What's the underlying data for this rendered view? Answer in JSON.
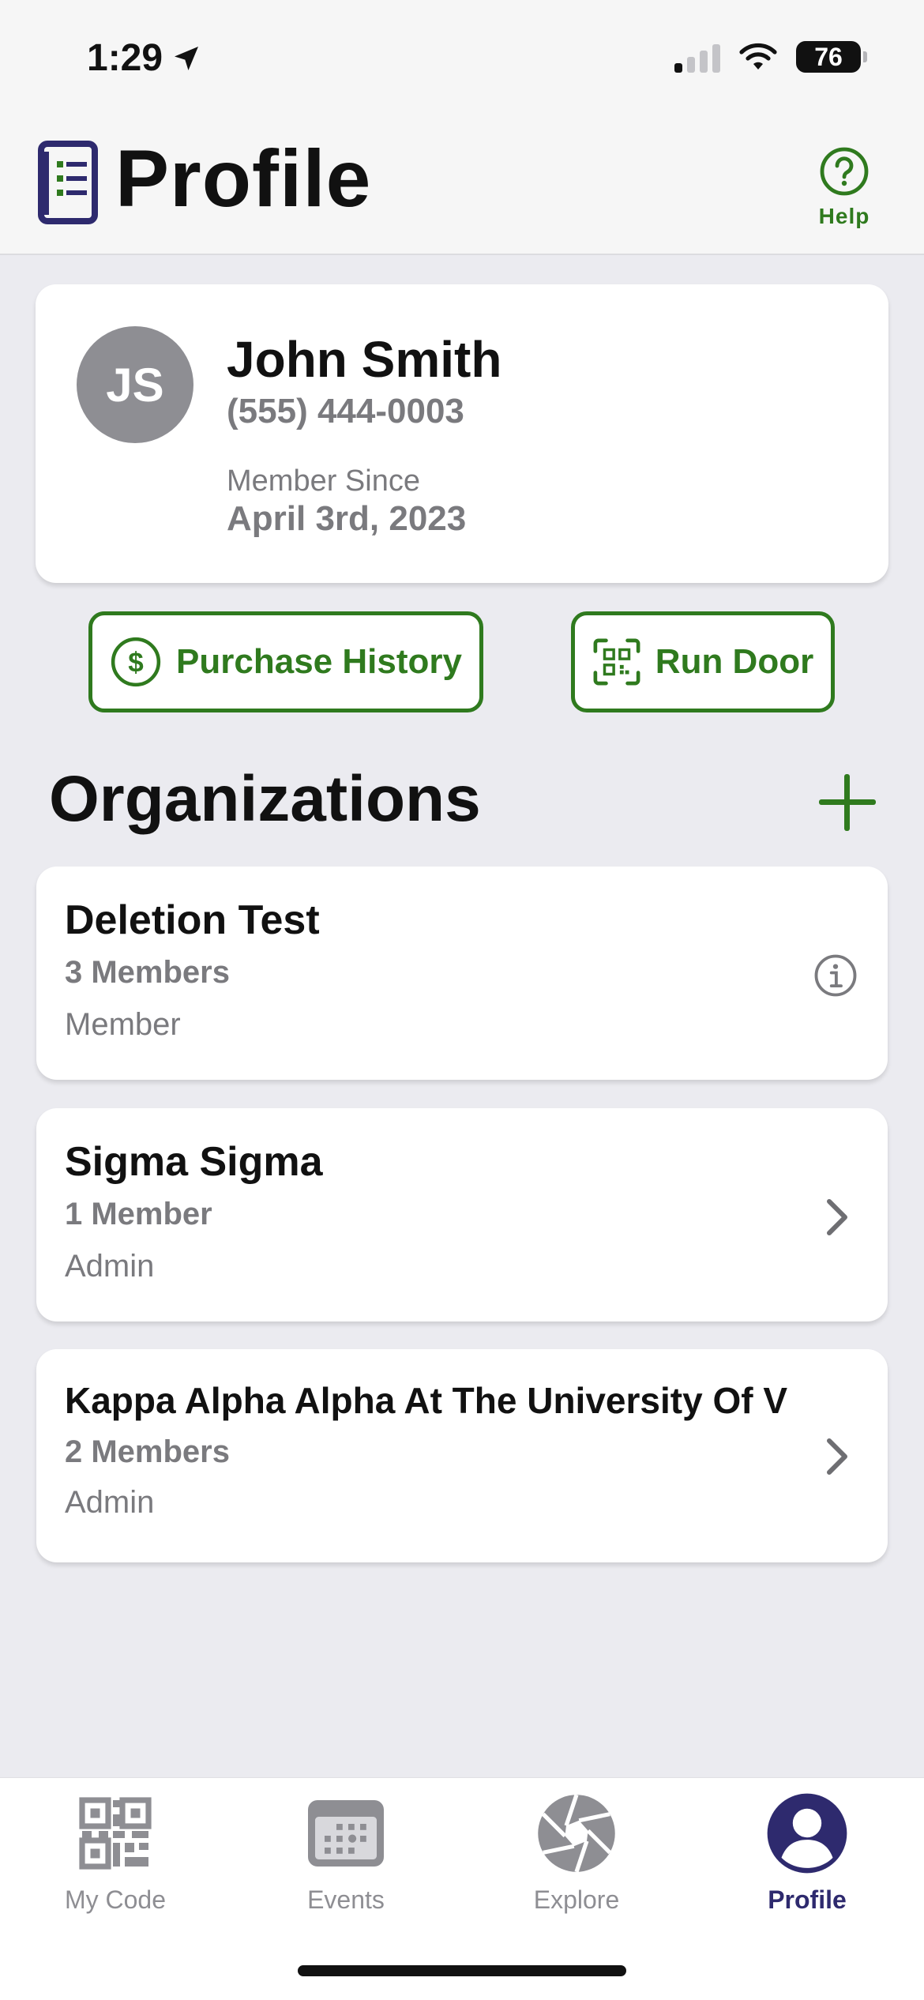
{
  "status_bar": {
    "time": "1:29",
    "battery": "76"
  },
  "header": {
    "title": "Profile",
    "help_label": "Help"
  },
  "profile": {
    "initials": "JS",
    "name": "John Smith",
    "phone": "(555) 444-0003",
    "member_since_label": "Member Since",
    "member_since_date": "April 3rd, 2023"
  },
  "actions": {
    "purchase_history": "Purchase History",
    "run_door": "Run Door"
  },
  "organizations": {
    "title": "Organizations",
    "items": [
      {
        "name": "Deletion Test",
        "members": "3 Members",
        "role": "Member",
        "icon": "info-icon"
      },
      {
        "name": "Sigma Sigma",
        "members": "1 Member",
        "role": "Admin",
        "icon": "chevron-right-icon"
      },
      {
        "name": "Kappa Alpha Alpha At The University Of V",
        "members": "2 Members",
        "role": "Admin",
        "icon": "chevron-right-icon"
      }
    ]
  },
  "tabbar": {
    "items": [
      {
        "label": "My Code",
        "icon": "qr-code-icon"
      },
      {
        "label": "Events",
        "icon": "calendar-icon"
      },
      {
        "label": "Explore",
        "icon": "aperture-icon"
      },
      {
        "label": "Profile",
        "icon": "person-icon",
        "active": true
      }
    ]
  },
  "colors": {
    "accent_green": "#2f7a1e",
    "brand_navy": "#2e2a6e",
    "muted_gray": "#8e8e93"
  }
}
